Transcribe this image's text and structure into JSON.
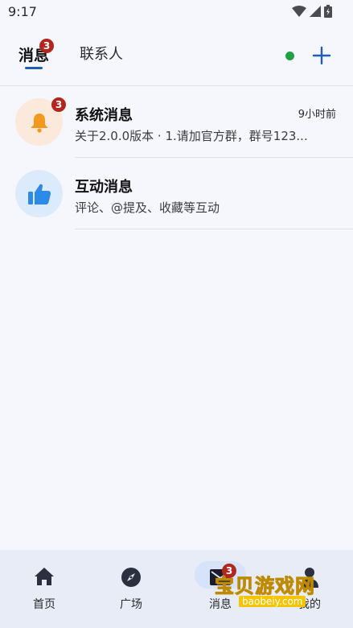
{
  "status_bar": {
    "time": "9:17"
  },
  "header": {
    "tabs": [
      {
        "label": "消息",
        "badge": "3",
        "active": true
      },
      {
        "label": "联系人",
        "active": false
      }
    ],
    "online_color": "#21a047"
  },
  "messages": [
    {
      "title": "系统消息",
      "subtitle": "关于2.0.0版本 · 1.请加官方群，群号123...",
      "time": "9小时前",
      "badge": "3",
      "icon": "bell-icon",
      "icon_color": "#f39a1e"
    },
    {
      "title": "互动消息",
      "subtitle": "评论、@提及、收藏等互动",
      "icon": "thumbs-up-icon",
      "icon_color": "#2d8be6"
    }
  ],
  "bottom_nav": {
    "items": [
      {
        "label": "首页",
        "icon": "home-icon"
      },
      {
        "label": "广场",
        "icon": "compass-icon"
      },
      {
        "label": "消息",
        "icon": "mail-icon",
        "badge": "3",
        "active": true
      },
      {
        "label": "我的",
        "icon": "person-icon"
      }
    ]
  },
  "watermark": {
    "text": "宝贝游戏网",
    "url": "baobeiy.com"
  }
}
